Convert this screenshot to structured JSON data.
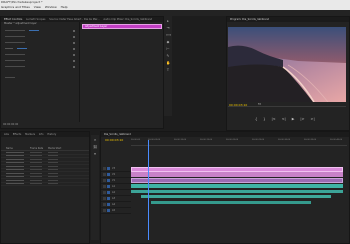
{
  "app": {
    "title": "DRAFT/Pinchetakesproject *",
    "menu": [
      "Graphics and Titles",
      "View",
      "Window",
      "Help"
    ]
  },
  "effect_controls": {
    "tabs": [
      "Effect Controls",
      "Lumetri Scopes",
      "Source: Deter Esse Albert - Dia de Mar...",
      "Audio Clip Mixer: Dia_Scrolls_ralkbrand"
    ],
    "master_label": "Master * adjustment layer",
    "clip_label": "Adjustment Layer",
    "rows": [
      {
        "label": "Opacity"
      },
      {
        "label": ""
      },
      {
        "label": ""
      },
      {
        "label": ""
      },
      {
        "label": ""
      },
      {
        "label": ""
      },
      {
        "label": ""
      },
      {
        "label": ""
      },
      {
        "label": ""
      }
    ],
    "timecode": "00:00:00:00"
  },
  "program_monitor": {
    "tab": "Program: Dia_Scrolls_ralkbrand",
    "timecode": "00:00:03:10",
    "fit": "Fit",
    "controls": [
      "{",
      "}",
      "|<",
      "<|",
      "▶",
      "|>",
      ">|"
    ]
  },
  "project": {
    "tabs": [
      "Libs",
      "Effects",
      "Markers",
      "Info",
      "History"
    ],
    "columns": [
      "Name",
      "Frame Rate",
      "Media Start"
    ],
    "items": [
      {
        "name": "",
        "rate": "",
        "start": ""
      },
      {
        "name": "",
        "rate": "",
        "start": ""
      },
      {
        "name": "",
        "rate": "",
        "start": ""
      },
      {
        "name": "",
        "rate": "",
        "start": ""
      },
      {
        "name": "",
        "rate": "",
        "start": ""
      },
      {
        "name": "",
        "rate": "",
        "start": ""
      },
      {
        "name": "",
        "rate": "",
        "start": ""
      },
      {
        "name": "",
        "rate": "",
        "start": ""
      },
      {
        "name": "",
        "rate": "",
        "start": ""
      },
      {
        "name": "",
        "rate": "",
        "start": ""
      }
    ]
  },
  "timeline": {
    "tab": "Dia_Scrolls_ralkbrand",
    "timecode": "00:00:03:10",
    "ruler": [
      "00:00:00",
      "00:00:05:00",
      "00:00:10:00",
      "00:00:15:00",
      "00:00:20:00",
      "00:00:25:00",
      "00:00:30:00",
      "00:00:35:00",
      "00:00:40:00"
    ],
    "video_tracks": [
      "V3",
      "V2",
      "V1"
    ],
    "audio_tracks": [
      "A1",
      "A2",
      "A3",
      "A4",
      "A5"
    ],
    "colors": {
      "adjustment": "#d98ad9",
      "video": "#9c6bb3",
      "audio": "#3fb3a5"
    }
  }
}
